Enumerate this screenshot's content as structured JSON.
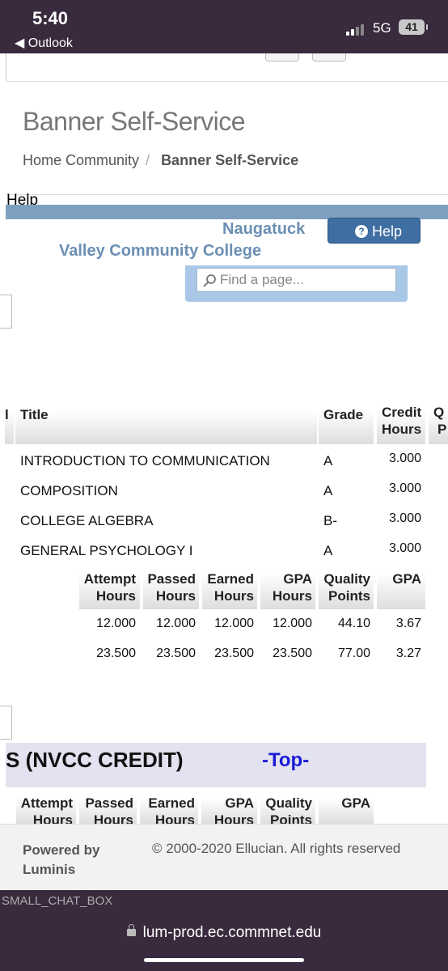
{
  "status_bar": {
    "time": "5:40",
    "back_app": "Outlook",
    "network": "5G",
    "battery": "41"
  },
  "page": {
    "title": "Banner Self-Service",
    "breadcrumb": {
      "home": "Home Community",
      "current": "Banner Self-Service"
    },
    "help_text": "Help",
    "college": {
      "line1": "Naugatuck",
      "line2": "Valley Community College"
    },
    "help_button": "Help",
    "search": {
      "placeholder": "Find a page..."
    }
  },
  "courses": {
    "headers": {
      "title": "Title",
      "grade": "Grade",
      "credit1": "Credit",
      "credit2": "Hours"
    },
    "rows": [
      {
        "title": "INTRODUCTION TO COMMUNICATION",
        "grade": "A",
        "credit": "3.000"
      },
      {
        "title": "COMPOSITION",
        "grade": "A",
        "credit": "3.000"
      },
      {
        "title": "COLLEGE ALGEBRA",
        "grade": "B-",
        "credit": "3.000"
      },
      {
        "title": "GENERAL PSYCHOLOGY I",
        "grade": "A",
        "credit": "3.000"
      }
    ]
  },
  "totals": {
    "headers": [
      {
        "l1": "Attempt",
        "l2": "Hours"
      },
      {
        "l1": "Passed",
        "l2": "Hours"
      },
      {
        "l1": "Earned",
        "l2": "Hours"
      },
      {
        "l1": "GPA",
        "l2": "Hours"
      },
      {
        "l1": "Quality",
        "l2": "Points"
      },
      {
        "l1": "GPA",
        "l2": ""
      }
    ],
    "rows": [
      [
        "12.000",
        "12.000",
        "12.000",
        "12.000",
        "44.10",
        "3.67"
      ],
      [
        "23.500",
        "23.500",
        "23.500",
        "23.500",
        "77.00",
        "3.27"
      ]
    ]
  },
  "section": {
    "title": "S (NVCC CREDIT)",
    "top_link": "-Top-"
  },
  "section_headers": [
    {
      "l1": "Attempt",
      "l2": "Hours"
    },
    {
      "l1": "Passed",
      "l2": "Hours"
    },
    {
      "l1": "Earned",
      "l2": "Hours"
    },
    {
      "l1": "GPA",
      "l2": "Hours"
    },
    {
      "l1": "Quality",
      "l2": "Points"
    },
    {
      "l1": "GPA",
      "l2": ""
    }
  ],
  "footer": {
    "powered": "Powered by Luminis",
    "copyright": "© 2000-2020 Ellucian. All rights reserved"
  },
  "chat": "SMALL_CHAT_BOX",
  "url": "lum-prod.ec.commnet.edu"
}
